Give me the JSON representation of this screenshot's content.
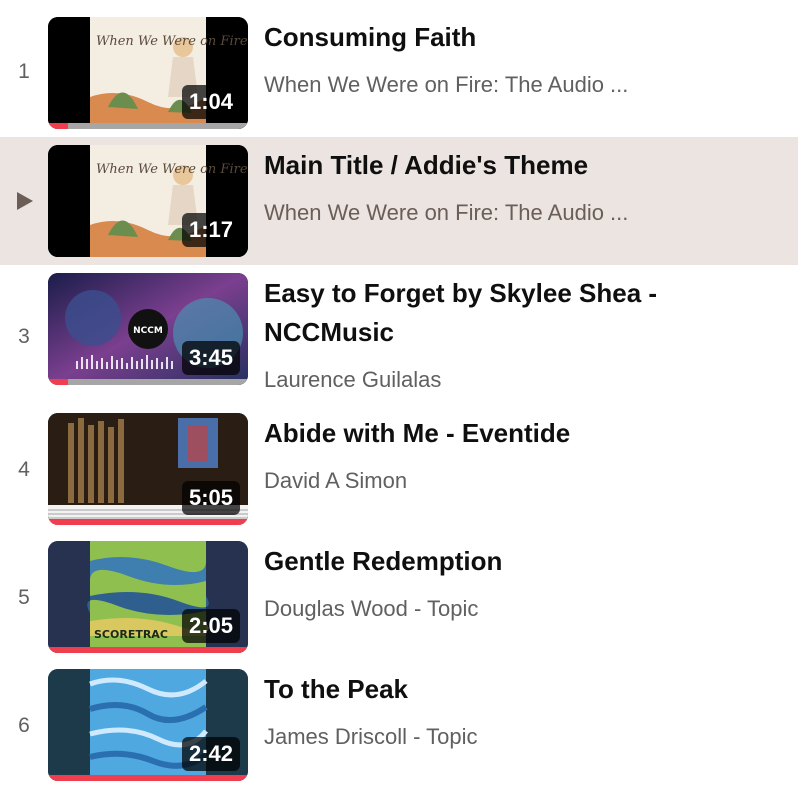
{
  "playlist": {
    "items": [
      {
        "index": "1",
        "title": "Consuming Faith",
        "channel": "When We Were on Fire: The Audio ...",
        "duration": "1:04",
        "active": false,
        "progress": 0.1,
        "thumb_text": "When We Were on Fire"
      },
      {
        "index": "",
        "title": "Main Title / Addie's Theme",
        "channel": "When We Were on Fire: The Audio ...",
        "duration": "1:17",
        "active": true,
        "progress": 0.0,
        "thumb_text": "When We Were on Fire"
      },
      {
        "index": "3",
        "title": "Easy to Forget by Skylee Shea - NCCMusic",
        "channel": "Laurence Guilalas",
        "duration": "3:45",
        "active": false,
        "progress": 0.1,
        "thumb_text": "NCCM"
      },
      {
        "index": "4",
        "title": "Abide with Me - Eventide",
        "channel": "David A Simon",
        "duration": "5:05",
        "active": false,
        "progress": 1.0,
        "thumb_text": ""
      },
      {
        "index": "5",
        "title": "Gentle Redemption",
        "channel": "Douglas Wood - Topic",
        "duration": "2:05",
        "active": false,
        "progress": 1.0,
        "thumb_text": "SCORETRAC"
      },
      {
        "index": "6",
        "title": "To the Peak",
        "channel": "James Driscoll - Topic",
        "duration": "2:42",
        "active": false,
        "progress": 1.0,
        "thumb_text": ""
      }
    ]
  },
  "icons": {
    "now_playing": "play-triangle-icon"
  },
  "colors": {
    "active_row_bg": "#ebe4e1",
    "progress_red": "#f03e4f",
    "title_text": "#0f0f0f",
    "secondary_text": "#606060"
  }
}
